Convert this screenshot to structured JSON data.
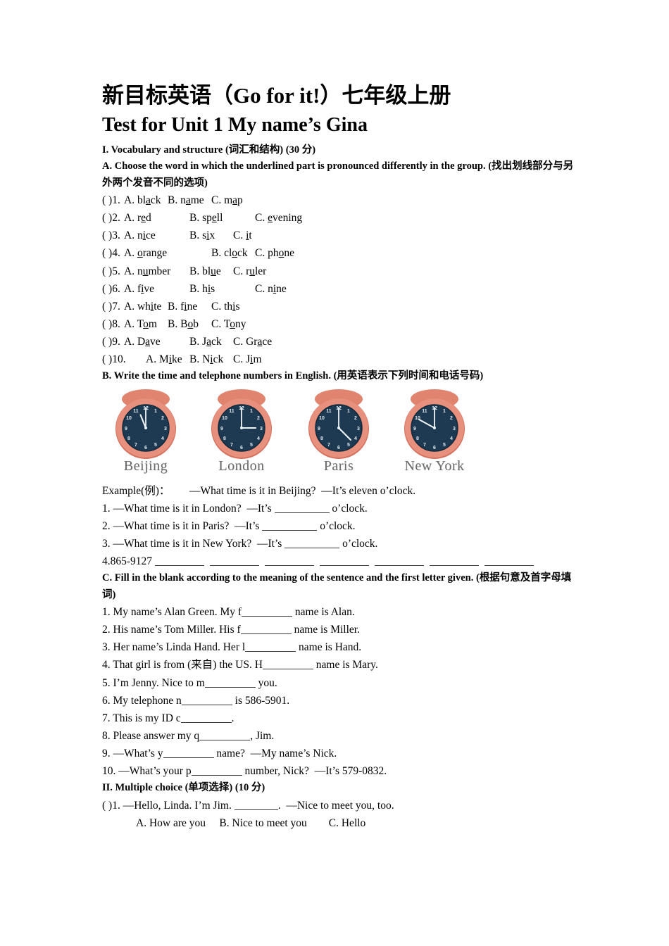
{
  "document": {
    "title_cn": "新目标英语（Go for it!）七年级上册",
    "title_en": "Test for Unit 1  My name’s Gina"
  },
  "section_1": {
    "heading": "I. Vocabulary and structure (词汇和结构) (30 分)",
    "part_a": {
      "heading": "A. Choose the word in which the underlined part is pronounced differently in the group. (找出划线部分与另外两个发音不同的选项)",
      "items": [
        {
          "num": "( )1.",
          "a_pre": "A. bl",
          "a_u": "a",
          "a_post": "ck",
          "b_pre": "B. n",
          "b_u": "a",
          "b_post": "me",
          "c_pre": "C. m",
          "c_u": "a",
          "c_post": "p"
        },
        {
          "num": "( )2.",
          "a_pre": "A. r",
          "a_u": "e",
          "a_post": "d",
          "b_pre": "B. sp",
          "b_u": "e",
          "b_post": "ll",
          "c_pre": "C. ",
          "c_u": "e",
          "c_post": "vening"
        },
        {
          "num": "( )3.",
          "a_pre": "A. n",
          "a_u": "i",
          "a_post": "ce",
          "b_pre": "B. s",
          "b_u": "i",
          "b_post": "x",
          "c_pre": "C. ",
          "c_u": "i",
          "c_post": "t"
        },
        {
          "num": "( )4.",
          "a_pre": "A. ",
          "a_u": "o",
          "a_post": "range",
          "b_pre": "B. cl",
          "b_u": "o",
          "b_post": "ck",
          "c_pre": "C. ph",
          "c_u": "o",
          "c_post": "ne"
        },
        {
          "num": "( )5.",
          "a_pre": "A. n",
          "a_u": "u",
          "a_post": "mber",
          "b_pre": "B. bl",
          "b_u": "u",
          "b_post": "e",
          "c_pre": "C. r",
          "c_u": "u",
          "c_post": "ler"
        },
        {
          "num": "( )6.",
          "a_pre": "A. f",
          "a_u": "i",
          "a_post": "ve",
          "b_pre": "B. h",
          "b_u": "i",
          "b_post": "s",
          "c_pre": "C. n",
          "c_u": "i",
          "c_post": "ne"
        },
        {
          "num": "( )7.",
          "a_pre": "A. wh",
          "a_u": "i",
          "a_post": "te",
          "b_pre": "B. f",
          "b_u": "i",
          "b_post": "ne",
          "c_pre": "C. th",
          "c_u": "i",
          "c_post": "s"
        },
        {
          "num": "( )8.",
          "a_pre": "A. T",
          "a_u": "o",
          "a_post": "m",
          "b_pre": "B. B",
          "b_u": "o",
          "b_post": "b",
          "c_pre": "C. T",
          "c_u": "o",
          "c_post": "ny"
        },
        {
          "num": "( )9.",
          "a_pre": "A. D",
          "a_u": "a",
          "a_post": "ve",
          "b_pre": "B. J",
          "b_u": "a",
          "b_post": "ck",
          "c_pre": "C. Gr",
          "c_u": "a",
          "c_post": "ce"
        },
        {
          "num": "( )10.",
          "a_pre": "A. M",
          "a_u": "i",
          "a_post": "ke",
          "b_pre": "B. N",
          "b_u": "i",
          "b_post": "ck",
          "c_pre": "C. J",
          "c_u": "i",
          "c_post": "m"
        }
      ]
    },
    "part_b": {
      "heading": "B. Write the time and telephone numbers in English. (用英语表示下列时间和电话号码)",
      "clocks": [
        {
          "city": "Beijing",
          "hour": 11,
          "minute": 0,
          "rim_color": "#e08a7c",
          "face_color": "#2e4a63"
        },
        {
          "city": "London",
          "hour": 3,
          "minute": 0,
          "rim_color": "#e08a7c",
          "face_color": "#2e4a63"
        },
        {
          "city": "Paris",
          "hour": 4,
          "minute": 0,
          "rim_color": "#e08a7c",
          "face_color": "#2e4a63"
        },
        {
          "city": "New York",
          "hour": 10,
          "minute": 0,
          "rim_color": "#e08a7c",
          "face_color": "#2e4a63"
        }
      ],
      "example_label": "Example(例)：",
      "example_text": "—What time is it in Beijing?  —It’s eleven o’clock.",
      "q1_pre": "1. —What time is it in London?  —It’s ",
      "q1_post": " o’clock.",
      "q2_pre": "2. —What time is it in Paris?  —It’s ",
      "q2_post": " o’clock.",
      "q3_pre": "3. —What time is it in New York?  —It’s ",
      "q3_post": " o’clock.",
      "q4_text": "4.865-9127",
      "q4_blank_count": 7
    },
    "part_c": {
      "heading": "C. Fill in the blank according to the meaning of the sentence and the first letter given. (根据句意及首字母填词)",
      "items": [
        {
          "pre": "1. My name’s Alan Green. My f",
          "post": " name is Alan."
        },
        {
          "pre": "2. His name’s Tom Miller. His f",
          "post": " name is Miller."
        },
        {
          "pre": "3. Her name’s Linda Hand. Her l",
          "post": " name is Hand."
        },
        {
          "pre": "4. That girl is from (来自) the US. H",
          "post": " name is Mary."
        },
        {
          "pre": "5. I’m Jenny. Nice to m",
          "post": " you."
        },
        {
          "pre": "6. My telephone n",
          "post": " is 586-5901."
        },
        {
          "pre": "7. This is my ID c",
          "post": "."
        },
        {
          "pre": "8. Please answer my q",
          "post": ", Jim."
        },
        {
          "pre": "9. —What’s y",
          "post": " name?  —My name’s Nick."
        },
        {
          "pre": "10. —What’s your p",
          "post": " number, Nick?  —It’s 579-0832."
        }
      ]
    }
  },
  "section_2": {
    "heading": "II. Multiple choice (单项选择) (10 分)",
    "q1_pre": "( )1. —Hello, Linda. I’m Jim. ",
    "q1_post": ".  —Nice to meet you, too.",
    "q1_options": "A. How are you     B. Nice to meet you        C. Hello"
  }
}
